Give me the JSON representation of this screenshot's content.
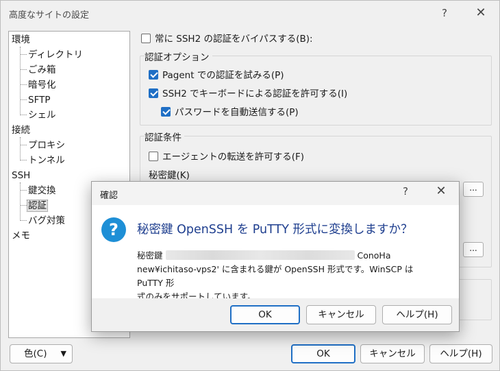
{
  "window": {
    "title": "高度なサイトの設定",
    "help_glyph": "?",
    "close_glyph": "✕"
  },
  "tree": {
    "items": [
      {
        "label": "環境",
        "level": 0
      },
      {
        "label": "ディレクトリ",
        "level": 1
      },
      {
        "label": "ごみ箱",
        "level": 1
      },
      {
        "label": "暗号化",
        "level": 1
      },
      {
        "label": "SFTP",
        "level": 1
      },
      {
        "label": "シェル",
        "level": 1
      },
      {
        "label": "接続",
        "level": 0
      },
      {
        "label": "プロキシ",
        "level": 1
      },
      {
        "label": "トンネル",
        "level": 1
      },
      {
        "label": "SSH",
        "level": 0
      },
      {
        "label": "鍵交換",
        "level": 1
      },
      {
        "label": "認証",
        "level": 1,
        "selected": true
      },
      {
        "label": "バグ対策",
        "level": 1
      },
      {
        "label": "メモ",
        "level": 0
      }
    ]
  },
  "panel": {
    "bypass_label": "常に SSH2 の認証をバイパスする(B):",
    "bypass_checked": false,
    "auth_options": {
      "label": "認証オプション",
      "pageant": {
        "label": "Pagent での認証を試みる(P)",
        "checked": true
      },
      "keyboard": {
        "label": "SSH2 でキーボードによる認証を許可する(I)",
        "checked": true
      },
      "auto_password": {
        "label": "パスワードを自動送信する(P)",
        "checked": true
      }
    },
    "auth_conditions": {
      "label": "認証条件",
      "agent_forward": {
        "label": "エージェントの転送を許可する(F)",
        "checked": false
      },
      "private_key_label": "秘密鍵(K)",
      "browse_label": "..."
    }
  },
  "footer": {
    "color_button": "色(C)",
    "color_arrow": "▼",
    "ok": "OK",
    "cancel": "キャンセル",
    "help": "ヘルプ(H)"
  },
  "dialog": {
    "title": "確認",
    "help_glyph": "?",
    "close_glyph": "✕",
    "icon_glyph": "?",
    "heading": "秘密鍵 OpenSSH を PuTTY 形式に変換しますか？",
    "message_prefix": "秘密鍵",
    "message_suffix": "ConoHa",
    "message_line2": "new¥ichitaso-vps2' に含まれる鍵が OpenSSH 形式です。WinSCP は PuTTY 形",
    "message_line3": "式のみをサポートしています。",
    "ok": "OK",
    "cancel": "キャンセル",
    "help": "ヘルプ(H)"
  }
}
